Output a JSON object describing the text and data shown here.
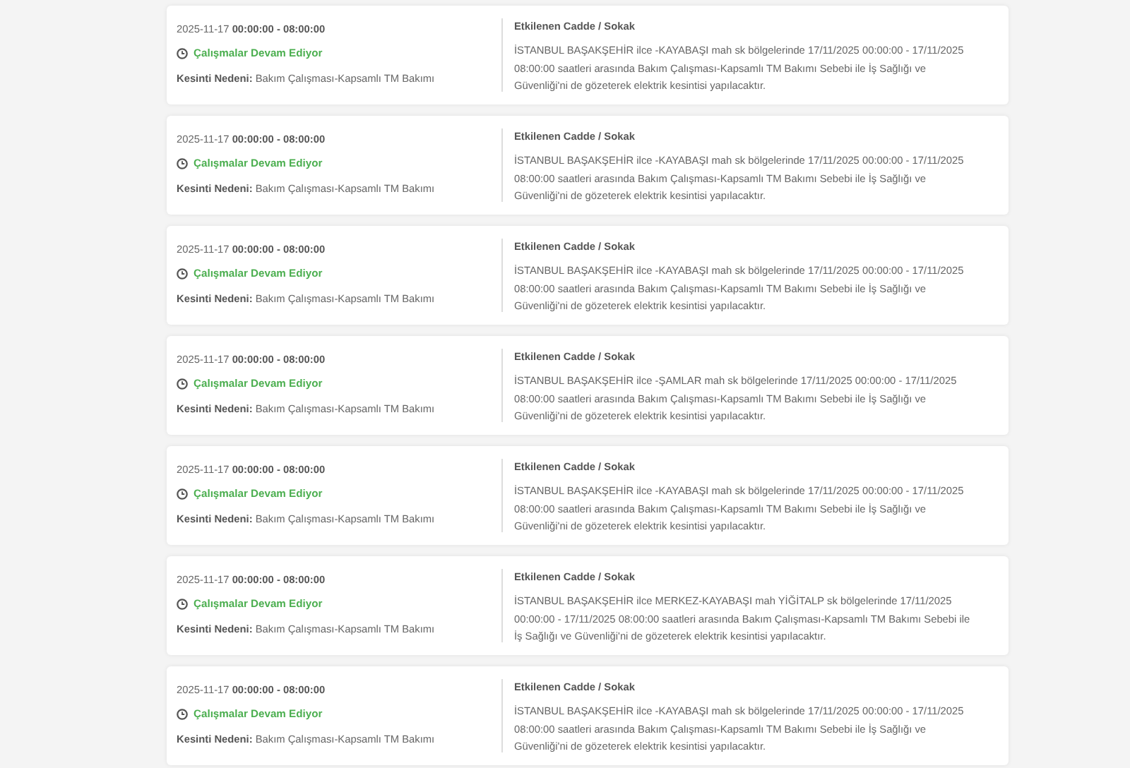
{
  "outages": [
    {
      "date_time": "2025-11-17 **00:00:00 - 08:00:00**",
      "status": "Çalışmalar Devam Ediyor",
      "reason": "**Kesinti Nedeni:** Bakım Çalışması-Kapsamlı TM Bakımı",
      "affected_heading": "Etkilenen Cadde / Sokak",
      "description": "İSTANBUL BAŞAKŞEHİR ilce -KAYABAŞI mah sk bölgelerinde 17/11/2025 00:00:00 - 17/11/2025 08:00:00 saatleri arasında Bakım Çalışması-Kapsamlı TM Bakımı Sebebi ile İş Sağlığı ve Güvenliği'ni de gözeterek elektrik kesintisi yapılacaktır."
    },
    {
      "date_time": "2025-11-17 **00:00:00 - 08:00:00**",
      "status": "Çalışmalar Devam Ediyor",
      "reason": "**Kesinti Nedeni:** Bakım Çalışması-Kapsamlı TM Bakımı",
      "affected_heading": "Etkilenen Cadde / Sokak",
      "description": "İSTANBUL BAŞAKŞEHİR ilce -KAYABAŞI mah sk bölgelerinde 17/11/2025 00:00:00 - 17/11/2025 08:00:00 saatleri arasında Bakım Çalışması-Kapsamlı TM Bakımı Sebebi ile İş Sağlığı ve Güvenliği'ni de gözeterek elektrik kesintisi yapılacaktır."
    },
    {
      "date_time": "2025-11-17 **00:00:00 - 08:00:00**",
      "status": "Çalışmalar Devam Ediyor",
      "reason": "**Kesinti Nedeni:** Bakım Çalışması-Kapsamlı TM Bakımı",
      "affected_heading": "Etkilenen Cadde / Sokak",
      "description": "İSTANBUL BAŞAKŞEHİR ilce -KAYABAŞI mah sk bölgelerinde 17/11/2025 00:00:00 - 17/11/2025 08:00:00 saatleri arasında Bakım Çalışması-Kapsamlı TM Bakımı Sebebi ile İş Sağlığı ve Güvenliği'ni de gözeterek elektrik kesintisi yapılacaktır."
    },
    {
      "date_time": "2025-11-17 **00:00:00 - 08:00:00**",
      "status": "Çalışmalar Devam Ediyor",
      "reason": "**Kesinti Nedeni:** Bakım Çalışması-Kapsamlı TM Bakımı",
      "affected_heading": "Etkilenen Cadde / Sokak",
      "description": "İSTANBUL BAŞAKŞEHİR ilce -ŞAMLAR mah sk bölgelerinde 17/11/2025 00:00:00 - 17/11/2025 08:00:00 saatleri arasında Bakım Çalışması-Kapsamlı TM Bakımı Sebebi ile İş Sağlığı ve Güvenliği'ni de gözeterek elektrik kesintisi yapılacaktır."
    },
    {
      "date_time": "2025-11-17 **00:00:00 - 08:00:00**",
      "status": "Çalışmalar Devam Ediyor",
      "reason": "**Kesinti Nedeni:** Bakım Çalışması-Kapsamlı TM Bakımı",
      "affected_heading": "Etkilenen Cadde / Sokak",
      "description": "İSTANBUL BAŞAKŞEHİR ilce -KAYABAŞI mah sk bölgelerinde 17/11/2025 00:00:00 - 17/11/2025 08:00:00 saatleri arasında Bakım Çalışması-Kapsamlı TM Bakımı Sebebi ile İş Sağlığı ve Güvenliği'ni de gözeterek elektrik kesintisi yapılacaktır."
    },
    {
      "date_time": "2025-11-17 **00:00:00 - 08:00:00**",
      "status": "Çalışmalar Devam Ediyor",
      "reason": "**Kesinti Nedeni:** Bakım Çalışması-Kapsamlı TM Bakımı",
      "affected_heading": "Etkilenen Cadde / Sokak",
      "description": "İSTANBUL BAŞAKŞEHİR ilce MERKEZ-KAYABAŞI mah YİĞİTALP sk bölgelerinde 17/11/2025 00:00:00 - 17/11/2025 08:00:00 saatleri arasında Bakım Çalışması-Kapsamlı TM Bakımı Sebebi ile İş Sağlığı ve Güvenliği'ni de gözeterek elektrik kesintisi yapılacaktır."
    },
    {
      "date_time": "2025-11-17 **00:00:00 - 08:00:00**",
      "status": "Çalışmalar Devam Ediyor",
      "reason": "**Kesinti Nedeni:** Bakım Çalışması-Kapsamlı TM Bakımı",
      "affected_heading": "Etkilenen Cadde / Sokak",
      "description": "İSTANBUL BAŞAKŞEHİR ilce -KAYABAŞI mah sk bölgelerinde 17/11/2025 00:00:00 - 17/11/2025 08:00:00 saatleri arasında Bakım Çalışması-Kapsamlı TM Bakımı Sebebi ile İş Sağlığı ve Güvenliği'ni de gözeterek elektrik kesintisi yapılacaktır."
    }
  ]
}
